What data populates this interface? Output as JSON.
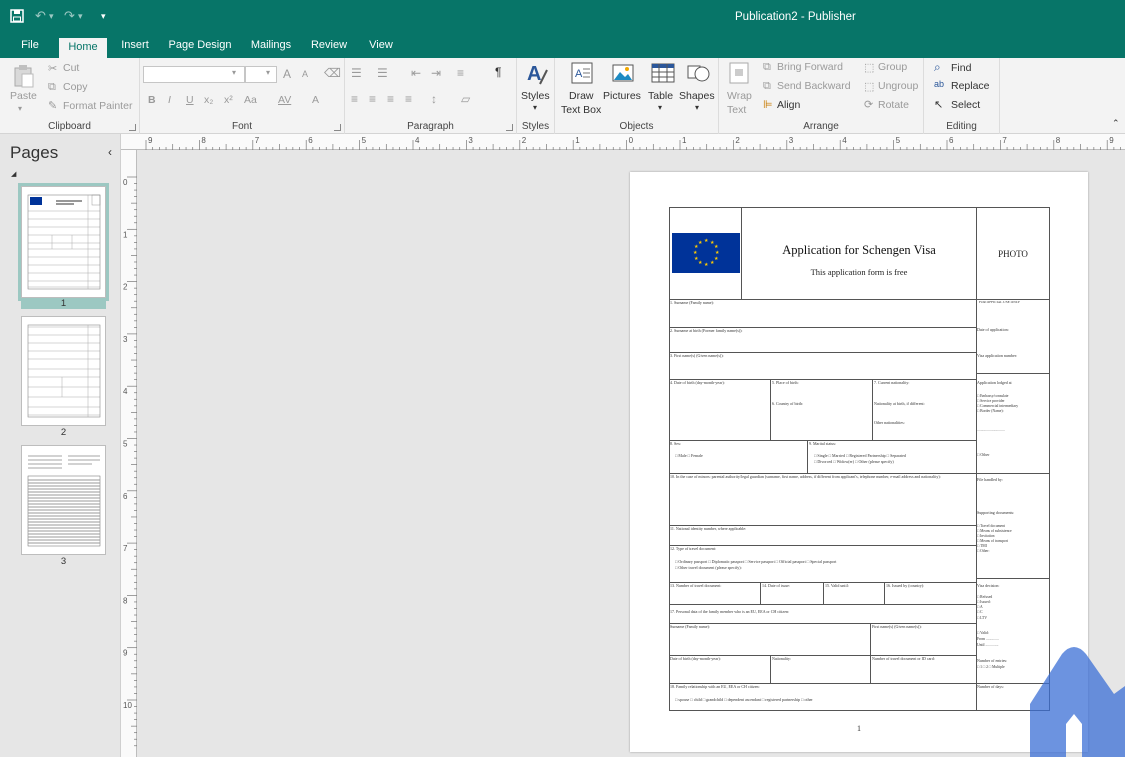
{
  "titlebar": {
    "window_title": "Publication2 - Publisher",
    "save_icon": "save-icon",
    "undo_icon": "undo-icon",
    "redo_icon": "redo-icon",
    "customize_icon": "customize-quick-access-icon"
  },
  "tabs": [
    {
      "label": "File"
    },
    {
      "label": "Home"
    },
    {
      "label": "Insert"
    },
    {
      "label": "Page Design"
    },
    {
      "label": "Mailings"
    },
    {
      "label": "Review"
    },
    {
      "label": "View"
    }
  ],
  "active_tab": "Home",
  "ribbon": {
    "clipboard": {
      "paste": "Paste",
      "cut": "Cut",
      "copy": "Copy",
      "format_painter": "Format Painter",
      "label": "Clipboard"
    },
    "font": {
      "bold": "B",
      "italic": "I",
      "underline": "U",
      "subscript": "x₂",
      "superscript": "x²",
      "change_case": "Aa",
      "spacing": "AV",
      "font_color": "A",
      "grow": "A",
      "shrink": "A",
      "label": "Font"
    },
    "paragraph": {
      "pilcrow": "¶",
      "label": "Paragraph"
    },
    "styles": {
      "styles": "Styles",
      "label": "Styles"
    },
    "objects": {
      "draw_text_box_1": "Draw",
      "draw_text_box_2": "Text Box",
      "pictures": "Pictures",
      "table": "Table",
      "shapes": "Shapes",
      "label": "Objects"
    },
    "arrange": {
      "wrap_1": "Wrap",
      "wrap_2": "Text",
      "bring_forward": "Bring Forward",
      "send_backward": "Send Backward",
      "align": "Align",
      "group": "Group",
      "ungroup": "Ungroup",
      "rotate": "Rotate",
      "label": "Arrange"
    },
    "editing": {
      "find": "Find",
      "replace": "Replace",
      "select": "Select",
      "label": "Editing"
    }
  },
  "pages_pane": {
    "title": "Pages",
    "collapse_icon": "chevron-left-icon",
    "pages": [
      {
        "number": "1"
      },
      {
        "number": "2"
      },
      {
        "number": "3"
      }
    ]
  },
  "hruler_labels": [
    "9",
    "8",
    "7",
    "6",
    "5",
    "4",
    "3",
    "2",
    "1",
    "0",
    "1",
    "2",
    "3",
    "4",
    "5",
    "6",
    "7",
    "8",
    "9"
  ],
  "vruler_labels": [
    "0",
    "1",
    "2",
    "3",
    "4",
    "5",
    "6",
    "7",
    "8",
    "9",
    "10"
  ],
  "document": {
    "title": "Application for Schengen Visa",
    "subtitle": "This application form is free",
    "photo": "PHOTO",
    "official_use": "FOR OFFICIAL USE ONLY",
    "fields": {
      "f1": "1. Surname (Family name):",
      "f2": "2. Surname at birth (Former family name(s)):",
      "f3": "3. First name(s) (Given name(s)):",
      "f4": "4. Date of birth (day-month-year):",
      "f5": "5. Place of birth:",
      "f6": "6. Country of birth:",
      "f7": "7. Current nationality:",
      "f7b": "Nationality at birth, if different:",
      "f7c": "Other nationalities:",
      "f8": "8. Sex:",
      "f8v": "□ Male □ Female",
      "f9": "9. Marital status:",
      "f9v1": "□ Single □ Married □ Registered Partnership □ Separated",
      "f9v2": "□ Divorced □ Widow(er) □ Other (please specify)",
      "f10": "10. In the case of minors: parental authority/legal guardian (surname, first name, address, if different from applicant's, telephone number, e-mail address and nationality):",
      "f11": "11. National identity number, where applicable:",
      "f12": "12. Type of travel document:",
      "f12v1": "□ Ordinary passport □ Diplomatic passport □ Service passport □ Official passport □ Special passport",
      "f12v2": "□ Other travel document (please specify):",
      "f13": "13. Number of travel document:",
      "f14": "14. Date of issue:",
      "f15": "15. Valid until:",
      "f16": "16. Issued by (country):",
      "f17": "17. Personal data of the family member who is an EU, EEA or CH citizen:",
      "f17a": "Surname (Family name):",
      "f17b": "First name(s) (Given name(s)):",
      "f17c": "Date of birth (day-month-year):",
      "f17d": "Nationality:",
      "f17e": "Number of travel document or ID card:",
      "f18": "18. Family relationship with an EU, EEA or CH citizen:",
      "f18v": "□ spouse □ child □ grandchild □ dependent ascendant □ registered partnership □ other"
    },
    "side": {
      "s1": "Date of application:",
      "s2": "Visa application number:",
      "s3": "Application lodged at",
      "s3a": "□ Embassy/consulate",
      "s3b": "□ Service provider",
      "s3c": "□ Commercial intermediary",
      "s3d": "□ Border (Name):",
      "s3e": "..............................",
      "s4": "□ Other",
      "s5": "File handled by:",
      "s6": "Supporting documents:",
      "s6a": "□ Travel document",
      "s6b": "□ Means of subsistence",
      "s6c": "□ Invitation",
      "s6d": "□ Means of transport",
      "s6e": "□ TMI",
      "s6f": "□ Other:",
      "s7": "Visa decision:",
      "s7a": "□ Refused",
      "s7b": "□ Issued:",
      "s7c": "□ A",
      "s7d": "□ C",
      "s7e": "□ LTV",
      "s7f": "□ Valid:",
      "s7g": "From ..............",
      "s7h": "Until ..............",
      "s8": "Number of entries:",
      "s8v": "□ 1 □ 2 □ Multiple",
      "s9": "Number of days:"
    },
    "page_number": "1"
  },
  "colors": {
    "accent": "#077568",
    "ribbon": "#f3f3f3",
    "eu_blue": "#003399",
    "eu_star": "#ffcc00",
    "watermark": "#3b6fd6"
  }
}
